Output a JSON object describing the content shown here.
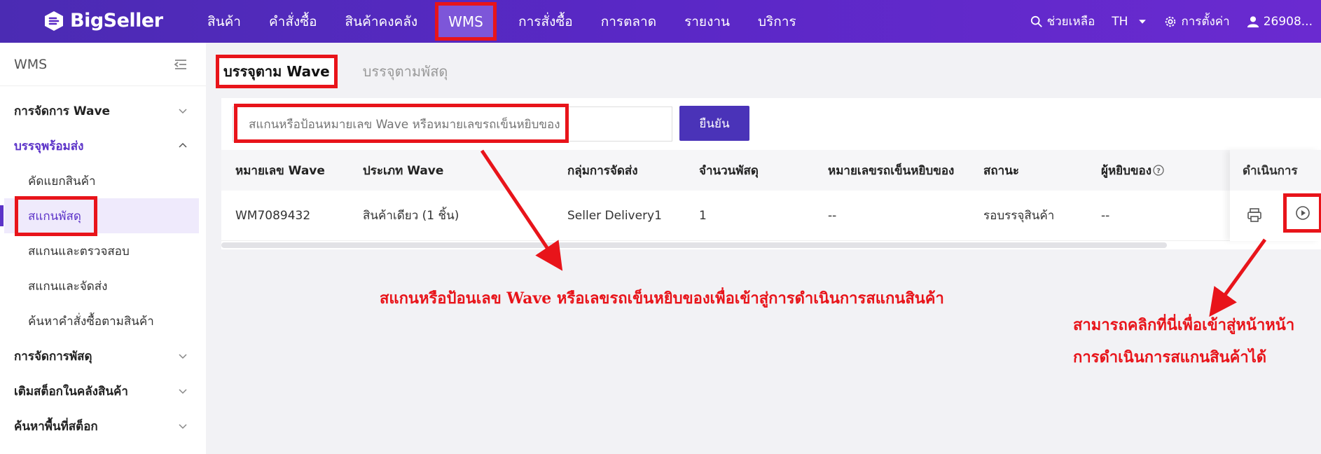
{
  "brand": {
    "name": "BigSeller"
  },
  "nav": {
    "items": [
      "สินค้า",
      "คำสั่งซื้อ",
      "สินค้าคงคลัง",
      "WMS",
      "การสั่งซื้อ",
      "การตลาด",
      "รายงาน",
      "บริการ"
    ],
    "active": "WMS"
  },
  "topright": {
    "help": "ช่วยเหลือ",
    "lang": "TH",
    "settings": "การตั้งค่า",
    "user": "26908..."
  },
  "sidebar": {
    "title": "WMS",
    "groups": [
      {
        "label": "การจัดการ Wave"
      },
      {
        "label": "บรรจุพร้อมส่ง",
        "children": [
          "คัดแยกสินค้า",
          "สแกนพัสดุ",
          "สแกนและตรวจสอบ",
          "สแกนและจัดส่ง",
          "ค้นหาคำสั่งซื้อตามสินค้า"
        ]
      },
      {
        "label": "การจัดการพัสดุ"
      },
      {
        "label": "เติมสต็อกในคลังสินค้า"
      },
      {
        "label": "ค้นหาพื้นที่สต็อก"
      }
    ]
  },
  "tabs": {
    "active": "บรรจุตาม Wave",
    "inactive": "บรรจุตามพัสดุ"
  },
  "search": {
    "placeholder": "สแกนหรือป้อนหมายเลข Wave หรือหมายเลขรถเข็นหยิบของ",
    "confirm": "ยืนยัน"
  },
  "table": {
    "headers": [
      "หมายเลข Wave",
      "ประเภท Wave",
      "กลุ่มการจัดส่ง",
      "จำนวนพัสดุ",
      "หมายเลขรถเข็นหยิบของ",
      "สถานะ",
      "ผู้หยิบของ",
      "ดำเนินการ"
    ],
    "row": [
      "WM7089432",
      "สินค้าเดียว (1 ชิ้น)",
      "Seller Delivery1",
      "1",
      "--",
      "รอบรรจุสินค้า",
      "--"
    ]
  },
  "annotations": {
    "a1": "สแกนหรือป้อนเลข Wave หรือเลขรถเข็นหยิบของเพื่อเข้าสู่การดำเนินการสแกนสินค้า",
    "a2_line1": "สามารถคลิกที่นี่เพื่อเข้าสู่หน้าหน้า",
    "a2_line2": "การดำเนินการสแกนสินค้าได้"
  },
  "colors": {
    "accent": "#4a33b8",
    "highlight": "#e8141a",
    "topbar": "#5a28c6"
  }
}
